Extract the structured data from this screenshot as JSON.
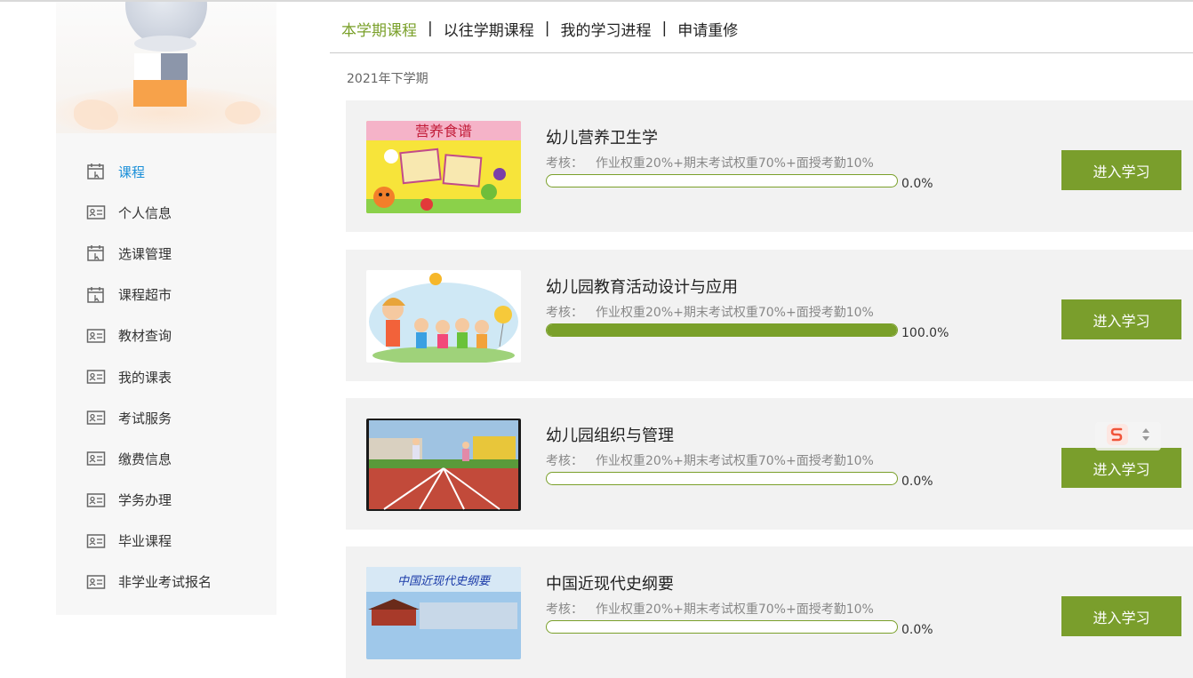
{
  "sidebar": {
    "items": [
      {
        "label": "课程",
        "icon": "calendar-icon"
      },
      {
        "label": "个人信息",
        "icon": "id-card-icon"
      },
      {
        "label": "选课管理",
        "icon": "calendar-icon"
      },
      {
        "label": "课程超市",
        "icon": "calendar-icon"
      },
      {
        "label": "教材查询",
        "icon": "id-card-icon"
      },
      {
        "label": "我的课表",
        "icon": "id-card-icon"
      },
      {
        "label": "考试服务",
        "icon": "id-card-icon"
      },
      {
        "label": "缴费信息",
        "icon": "id-card-icon"
      },
      {
        "label": "学务办理",
        "icon": "id-card-icon"
      },
      {
        "label": "毕业课程",
        "icon": "id-card-icon"
      },
      {
        "label": "非学业考试报名",
        "icon": "id-card-icon"
      }
    ],
    "active_index": 0,
    "accent_color": "#1a8fd8"
  },
  "tabs": [
    {
      "label": "本学期课程",
      "active": true
    },
    {
      "label": "以往学期课程",
      "active": false
    },
    {
      "label": "我的学习进程",
      "active": false
    },
    {
      "label": "申请重修",
      "active": false
    }
  ],
  "tab_separator": "|",
  "term_label": "2021年下学期",
  "assess_label": "考核：",
  "enter_label": "进入学习",
  "courses": [
    {
      "title": "幼儿营养卫生学",
      "assessment": "作业权重20%+期末考试权重70%+面授考勤10%",
      "progress": 0.0,
      "progress_text": "0.0%",
      "thumb_caption": "营养食谱"
    },
    {
      "title": "幼儿园教育活动设计与应用",
      "assessment": "作业权重20%+期末考试权重70%+面授考勤10%",
      "progress": 100.0,
      "progress_text": "100.0%"
    },
    {
      "title": "幼儿园组织与管理",
      "assessment": "作业权重20%+期末考试权重70%+面授考勤10%",
      "progress": 0.0,
      "progress_text": "0.0%"
    },
    {
      "title": "中国近现代史纲要",
      "assessment": "作业权重20%+期末考试权重70%+面授考勤10%",
      "progress": 0.0,
      "progress_text": "0.0%",
      "thumb_caption": "中国近现代史纲要"
    }
  ],
  "colors": {
    "accent_green": "#7a9e2c",
    "card_bg": "#f2f2f2"
  }
}
